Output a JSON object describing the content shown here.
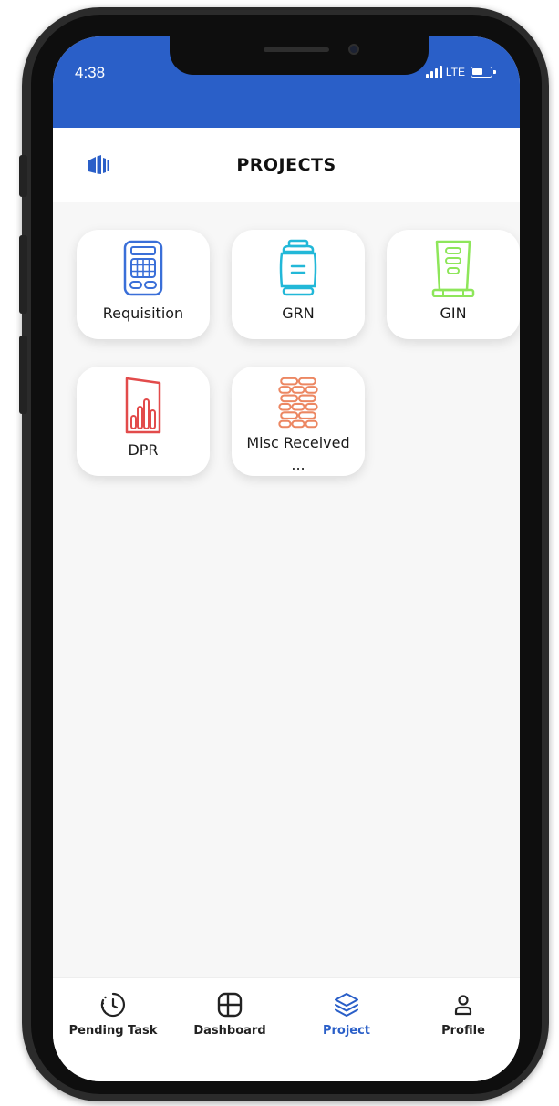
{
  "status_bar": {
    "time": "4:38",
    "network": "LTE"
  },
  "header": {
    "title": "PROJECTS",
    "logo_icon": "building-logo-icon"
  },
  "tiles": [
    {
      "label": "Requisition",
      "icon": "calculator-icon",
      "color": "#3a6fd8"
    },
    {
      "label": "GRN",
      "icon": "cylinder-container-icon",
      "color": "#22b8d8"
    },
    {
      "label": "GIN",
      "icon": "tall-container-icon",
      "color": "#8ee65a"
    },
    {
      "label": "DPR",
      "icon": "bar-report-icon",
      "color": "#e24b4b"
    },
    {
      "label": "Misc Received ...",
      "icon": "brick-stack-icon",
      "color": "#ec8762"
    }
  ],
  "bottom_nav": {
    "active": "Project",
    "active_color": "#2a5fc8",
    "items": [
      {
        "label": "Pending Task",
        "icon": "clock-icon"
      },
      {
        "label": "Dashboard",
        "icon": "grid-panel-icon"
      },
      {
        "label": "Project",
        "icon": "layers-icon"
      },
      {
        "label": "Profile",
        "icon": "person-icon"
      }
    ]
  },
  "colors": {
    "brand_blue": "#2a5fc8",
    "background": "#f7f7f7"
  }
}
